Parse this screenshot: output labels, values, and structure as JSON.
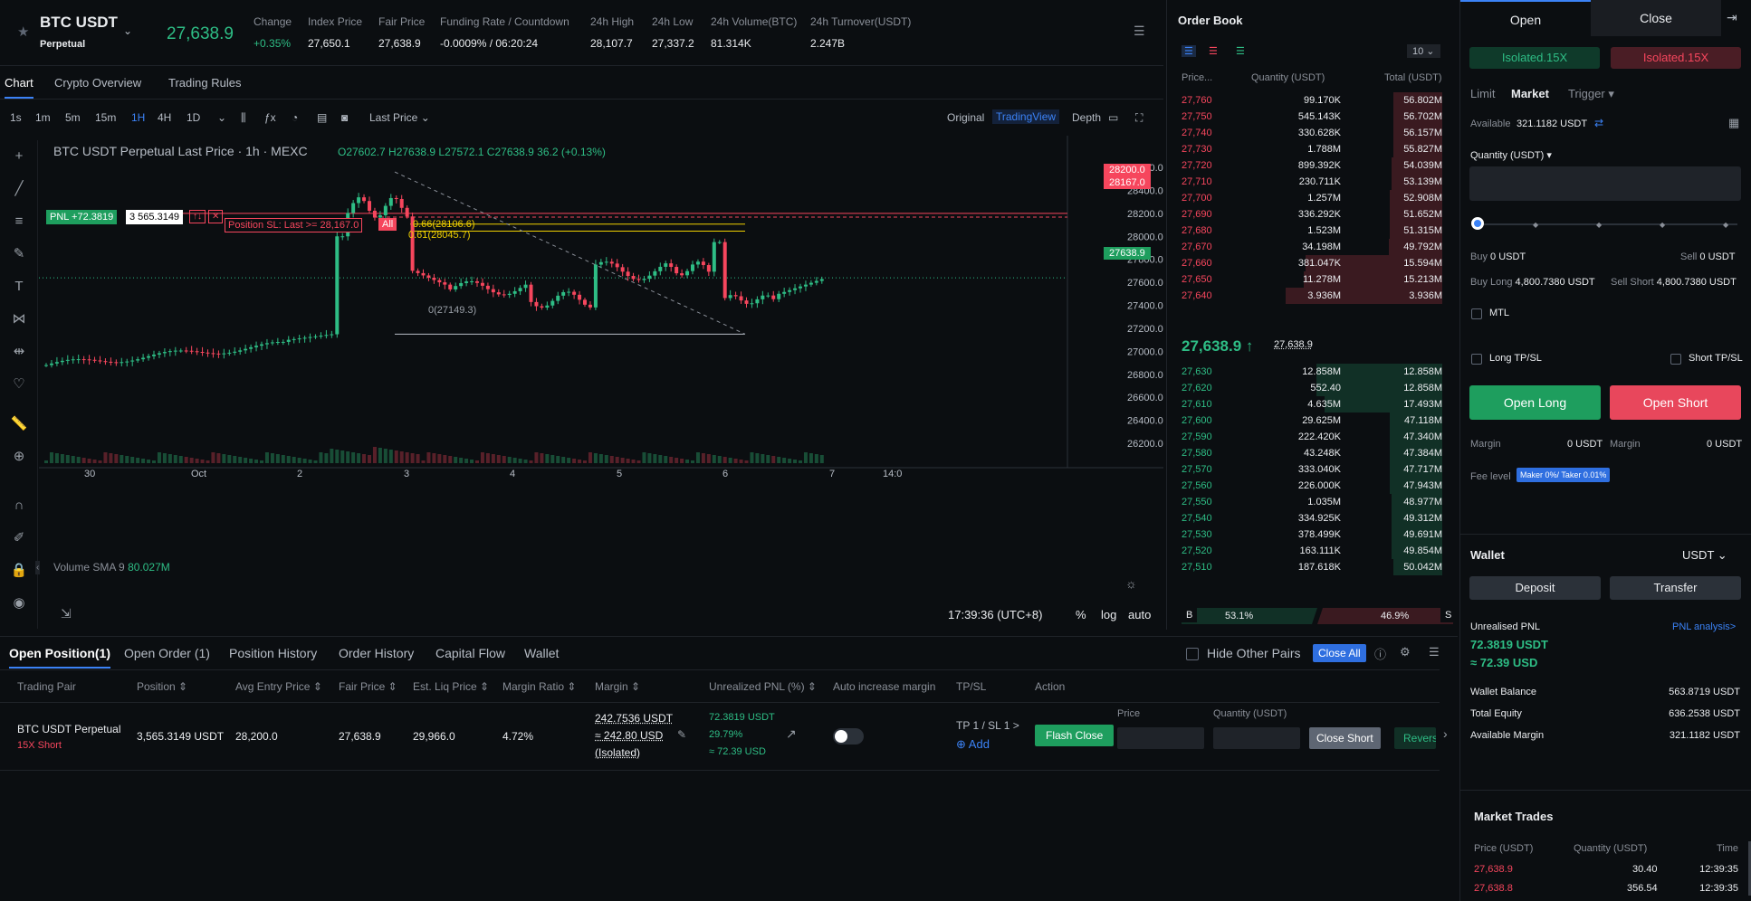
{
  "header": {
    "symbol": "BTC USDT",
    "type": "Perpetual",
    "last_price": "27,638.9",
    "stats": [
      {
        "label": "Change",
        "value": "+0.35%"
      },
      {
        "label": "Index Price",
        "value": "27,650.1"
      },
      {
        "label": "Fair Price",
        "value": "27,638.9"
      },
      {
        "label": "Funding Rate / Countdown",
        "value": "-0.0009% / 06:20:24"
      },
      {
        "label": "24h High",
        "value": "28,107.7"
      },
      {
        "label": "24h Low",
        "value": "27,337.2"
      },
      {
        "label": "24h Volume(BTC)",
        "value": "81.314K"
      },
      {
        "label": "24h Turnover(USDT)",
        "value": "2.247B"
      }
    ]
  },
  "tabs": [
    "Chart",
    "Crypto Overview",
    "Trading Rules"
  ],
  "toolbar": {
    "intervals": [
      "1s",
      "1m",
      "5m",
      "15m",
      "1H",
      "4H",
      "1D"
    ],
    "price_type": "Last Price",
    "views": [
      "Original",
      "TradingView",
      "Depth"
    ]
  },
  "chart": {
    "legend": "BTC USDT Perpetual Last Price · 1h · MEXC",
    "ohlc": "O27602.7 H27638.9 L27572.1 C27638.9 36.2 (+0.13%)",
    "pnl_tag": "PNL +72.3819",
    "pnl_qty": "3 565.3149",
    "sl_tag": "Position SL: Last >= 28,167.0",
    "sl_all": "All",
    "fib": [
      "0.66(28106.6)",
      "0.61(28045.7)",
      "0(27149.3)"
    ],
    "price_labels": [
      "28200.0",
      "28167.0",
      "27638.9"
    ],
    "y_ticks": [
      "28600.0",
      "28400.0",
      "28200.0",
      "28000.0",
      "27800.0",
      "27600.0",
      "27400.0",
      "27200.0",
      "27000.0",
      "26800.0",
      "26600.0",
      "26400.0",
      "26200.0"
    ],
    "x_ticks": [
      "30",
      "Oct",
      "2",
      "3",
      "4",
      "5",
      "6",
      "7",
      "14:0"
    ],
    "volume_label": "Volume SMA 9",
    "volume_value": "80.027M",
    "time": "17:39:36 (UTC+8)",
    "opts": [
      "%",
      "log",
      "auto"
    ]
  },
  "chart_data": {
    "type": "candlestick",
    "title": "BTC USDT Perpetual Last Price · 1h · MEXC",
    "ylim": [
      26200,
      28600
    ],
    "x_labels": [
      "30",
      "Oct",
      "2",
      "3",
      "4",
      "5",
      "6",
      "7"
    ],
    "last": 27638.9,
    "high": 28107.7,
    "low": 27337.2
  },
  "orderbook": {
    "title": "Order Book",
    "depth": "10",
    "cols": [
      "Price...",
      "Quantity (USDT)",
      "Total (USDT)"
    ],
    "asks": [
      [
        "27,760",
        "99.170K",
        "56.802M"
      ],
      [
        "27,750",
        "545.143K",
        "56.702M"
      ],
      [
        "27,740",
        "330.628K",
        "56.157M"
      ],
      [
        "27,730",
        "1.788M",
        "55.827M"
      ],
      [
        "27,720",
        "899.392K",
        "54.039M"
      ],
      [
        "27,710",
        "230.711K",
        "53.139M"
      ],
      [
        "27,700",
        "1.257M",
        "52.908M"
      ],
      [
        "27,690",
        "336.292K",
        "51.652M"
      ],
      [
        "27,680",
        "1.523M",
        "51.315M"
      ],
      [
        "27,670",
        "34.198M",
        "49.792M"
      ],
      [
        "27,660",
        "381.047K",
        "15.594M"
      ],
      [
        "27,650",
        "11.278M",
        "15.213M"
      ],
      [
        "27,640",
        "3.936M",
        "3.936M"
      ]
    ],
    "ask_fill": [
      0.3,
      0.3,
      0.3,
      0.3,
      0.31,
      0.31,
      0.32,
      0.32,
      0.32,
      0.33,
      0.84,
      0.85,
      0.96
    ],
    "mid": "27,638.9",
    "mid_arrow": "↑",
    "mid_sub": "27,638.9",
    "bids": [
      [
        "27,630",
        "12.858M",
        "12.858M"
      ],
      [
        "27,620",
        "552.40",
        "12.858M"
      ],
      [
        "27,610",
        "4.635M",
        "17.493M"
      ],
      [
        "27,600",
        "29.625M",
        "47.118M"
      ],
      [
        "27,590",
        "222.420K",
        "47.340M"
      ],
      [
        "27,580",
        "43.248K",
        "47.384M"
      ],
      [
        "27,570",
        "333.040K",
        "47.717M"
      ],
      [
        "27,560",
        "226.000K",
        "47.943M"
      ],
      [
        "27,550",
        "1.035M",
        "48.977M"
      ],
      [
        "27,540",
        "334.925K",
        "49.312M"
      ],
      [
        "27,530",
        "378.499K",
        "49.691M"
      ],
      [
        "27,520",
        "163.111K",
        "49.854M"
      ],
      [
        "27,510",
        "187.618K",
        "50.042M"
      ]
    ],
    "bid_fill": [
      0.77,
      0.77,
      0.72,
      0.32,
      0.32,
      0.32,
      0.32,
      0.32,
      0.31,
      0.31,
      0.31,
      0.31,
      0.3
    ],
    "buy_label": "B",
    "buy_pct": "53.1%",
    "sell_pct": "46.9%",
    "sell_label": "S"
  },
  "trade": {
    "tabs": [
      "Open",
      "Close"
    ],
    "margin_modes": [
      "Isolated.15X",
      "Isolated.15X"
    ],
    "order_types": [
      "Limit",
      "Market",
      "Trigger"
    ],
    "available_label": "Available",
    "available": "321.1182 USDT",
    "qty_label": "Quantity (USDT)",
    "buy": "Buy",
    "buy_val": "0 USDT",
    "sell": "Sell",
    "sell_val": "0 USDT",
    "buy_long": "Buy Long",
    "buy_long_val": "4,800.7380 USDT",
    "sell_short": "Sell Short",
    "sell_short_val": "4,800.7380 USDT",
    "mtl": "MTL",
    "long_tpsl": "Long TP/SL",
    "short_tpsl": "Short TP/SL",
    "open_long": "Open Long",
    "open_short": "Open Short",
    "margin_label": "Margin",
    "margin_left": "0 USDT",
    "margin_right": "0 USDT",
    "fee_label": "Fee level",
    "fee_badge": "Maker 0%/ Taker 0.01%"
  },
  "wallet": {
    "title": "Wallet",
    "currency": "USDT",
    "deposit": "Deposit",
    "transfer": "Transfer",
    "unrealised_label": "Unrealised PNL",
    "pnl_link": "PNL analysis>",
    "unrealised": "72.3819 USDT",
    "unrealised_usd": "≈ 72.39 USD",
    "rows": [
      [
        "Wallet Balance",
        "563.8719 USDT"
      ],
      [
        "Total Equity",
        "636.2538 USDT"
      ],
      [
        "Available Margin",
        "321.1182 USDT"
      ]
    ]
  },
  "market_trades": {
    "title": "Market Trades",
    "cols": [
      "Price (USDT)",
      "Quantity (USDT)",
      "Time"
    ],
    "rows": [
      [
        "27,638.9",
        "30.40",
        "12:39:35"
      ],
      [
        "27,638.8",
        "356.54",
        "12:39:35"
      ]
    ]
  },
  "positions": {
    "tabs": [
      "Open Position(1)",
      "Open Order (1)",
      "Position History",
      "Order History",
      "Capital Flow",
      "Wallet"
    ],
    "hide_pairs": "Hide Other Pairs",
    "close_all": "Close All",
    "cols": [
      "Trading Pair",
      "Position",
      "Avg Entry Price",
      "Fair Price",
      "Est. Liq Price",
      "Margin Ratio",
      "Margin",
      "Unrealized PNL (%)",
      "Auto increase margin",
      "TP/SL",
      "Action"
    ],
    "row": {
      "pair": "BTC USDT Perpetual",
      "side": "15X Short",
      "position": "3,565.3149 USDT",
      "entry": "28,200.0",
      "fair": "27,638.9",
      "liq": "29,966.0",
      "ratio": "4.72%",
      "margin1": "242.7536 USDT",
      "margin2": "≈ 242.80 USD",
      "margin3": "(Isolated)",
      "pnl1": "72.3819 USDT",
      "pnl2": "29.79%",
      "pnl3": "≈ 72.39 USD",
      "tpsl": "TP 1 / SL 1 >",
      "add": "Add",
      "flash": "Flash Close",
      "price_label": "Price",
      "qty_label": "Quantity (USDT)",
      "close_short": "Close Short",
      "reverse": "Revers"
    }
  }
}
